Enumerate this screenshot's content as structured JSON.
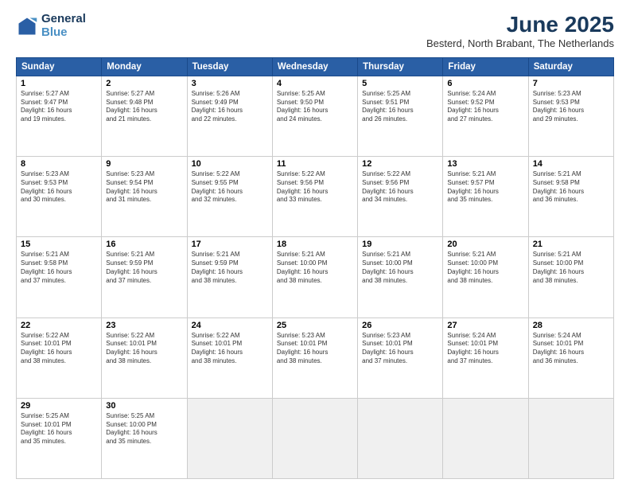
{
  "logo": {
    "line1": "General",
    "line2": "Blue"
  },
  "title": "June 2025",
  "subtitle": "Besterd, North Brabant, The Netherlands",
  "days_of_week": [
    "Sunday",
    "Monday",
    "Tuesday",
    "Wednesday",
    "Thursday",
    "Friday",
    "Saturday"
  ],
  "weeks": [
    [
      {
        "day": 1,
        "info": "Sunrise: 5:27 AM\nSunset: 9:47 PM\nDaylight: 16 hours\nand 19 minutes."
      },
      {
        "day": 2,
        "info": "Sunrise: 5:27 AM\nSunset: 9:48 PM\nDaylight: 16 hours\nand 21 minutes."
      },
      {
        "day": 3,
        "info": "Sunrise: 5:26 AM\nSunset: 9:49 PM\nDaylight: 16 hours\nand 22 minutes."
      },
      {
        "day": 4,
        "info": "Sunrise: 5:25 AM\nSunset: 9:50 PM\nDaylight: 16 hours\nand 24 minutes."
      },
      {
        "day": 5,
        "info": "Sunrise: 5:25 AM\nSunset: 9:51 PM\nDaylight: 16 hours\nand 26 minutes."
      },
      {
        "day": 6,
        "info": "Sunrise: 5:24 AM\nSunset: 9:52 PM\nDaylight: 16 hours\nand 27 minutes."
      },
      {
        "day": 7,
        "info": "Sunrise: 5:23 AM\nSunset: 9:53 PM\nDaylight: 16 hours\nand 29 minutes."
      }
    ],
    [
      {
        "day": 8,
        "info": "Sunrise: 5:23 AM\nSunset: 9:53 PM\nDaylight: 16 hours\nand 30 minutes."
      },
      {
        "day": 9,
        "info": "Sunrise: 5:23 AM\nSunset: 9:54 PM\nDaylight: 16 hours\nand 31 minutes."
      },
      {
        "day": 10,
        "info": "Sunrise: 5:22 AM\nSunset: 9:55 PM\nDaylight: 16 hours\nand 32 minutes."
      },
      {
        "day": 11,
        "info": "Sunrise: 5:22 AM\nSunset: 9:56 PM\nDaylight: 16 hours\nand 33 minutes."
      },
      {
        "day": 12,
        "info": "Sunrise: 5:22 AM\nSunset: 9:56 PM\nDaylight: 16 hours\nand 34 minutes."
      },
      {
        "day": 13,
        "info": "Sunrise: 5:21 AM\nSunset: 9:57 PM\nDaylight: 16 hours\nand 35 minutes."
      },
      {
        "day": 14,
        "info": "Sunrise: 5:21 AM\nSunset: 9:58 PM\nDaylight: 16 hours\nand 36 minutes."
      }
    ],
    [
      {
        "day": 15,
        "info": "Sunrise: 5:21 AM\nSunset: 9:58 PM\nDaylight: 16 hours\nand 37 minutes."
      },
      {
        "day": 16,
        "info": "Sunrise: 5:21 AM\nSunset: 9:59 PM\nDaylight: 16 hours\nand 37 minutes."
      },
      {
        "day": 17,
        "info": "Sunrise: 5:21 AM\nSunset: 9:59 PM\nDaylight: 16 hours\nand 38 minutes."
      },
      {
        "day": 18,
        "info": "Sunrise: 5:21 AM\nSunset: 10:00 PM\nDaylight: 16 hours\nand 38 minutes."
      },
      {
        "day": 19,
        "info": "Sunrise: 5:21 AM\nSunset: 10:00 PM\nDaylight: 16 hours\nand 38 minutes."
      },
      {
        "day": 20,
        "info": "Sunrise: 5:21 AM\nSunset: 10:00 PM\nDaylight: 16 hours\nand 38 minutes."
      },
      {
        "day": 21,
        "info": "Sunrise: 5:21 AM\nSunset: 10:00 PM\nDaylight: 16 hours\nand 38 minutes."
      }
    ],
    [
      {
        "day": 22,
        "info": "Sunrise: 5:22 AM\nSunset: 10:01 PM\nDaylight: 16 hours\nand 38 minutes."
      },
      {
        "day": 23,
        "info": "Sunrise: 5:22 AM\nSunset: 10:01 PM\nDaylight: 16 hours\nand 38 minutes."
      },
      {
        "day": 24,
        "info": "Sunrise: 5:22 AM\nSunset: 10:01 PM\nDaylight: 16 hours\nand 38 minutes."
      },
      {
        "day": 25,
        "info": "Sunrise: 5:23 AM\nSunset: 10:01 PM\nDaylight: 16 hours\nand 38 minutes."
      },
      {
        "day": 26,
        "info": "Sunrise: 5:23 AM\nSunset: 10:01 PM\nDaylight: 16 hours\nand 37 minutes."
      },
      {
        "day": 27,
        "info": "Sunrise: 5:24 AM\nSunset: 10:01 PM\nDaylight: 16 hours\nand 37 minutes."
      },
      {
        "day": 28,
        "info": "Sunrise: 5:24 AM\nSunset: 10:01 PM\nDaylight: 16 hours\nand 36 minutes."
      }
    ],
    [
      {
        "day": 29,
        "info": "Sunrise: 5:25 AM\nSunset: 10:01 PM\nDaylight: 16 hours\nand 35 minutes."
      },
      {
        "day": 30,
        "info": "Sunrise: 5:25 AM\nSunset: 10:00 PM\nDaylight: 16 hours\nand 35 minutes."
      },
      null,
      null,
      null,
      null,
      null
    ]
  ]
}
